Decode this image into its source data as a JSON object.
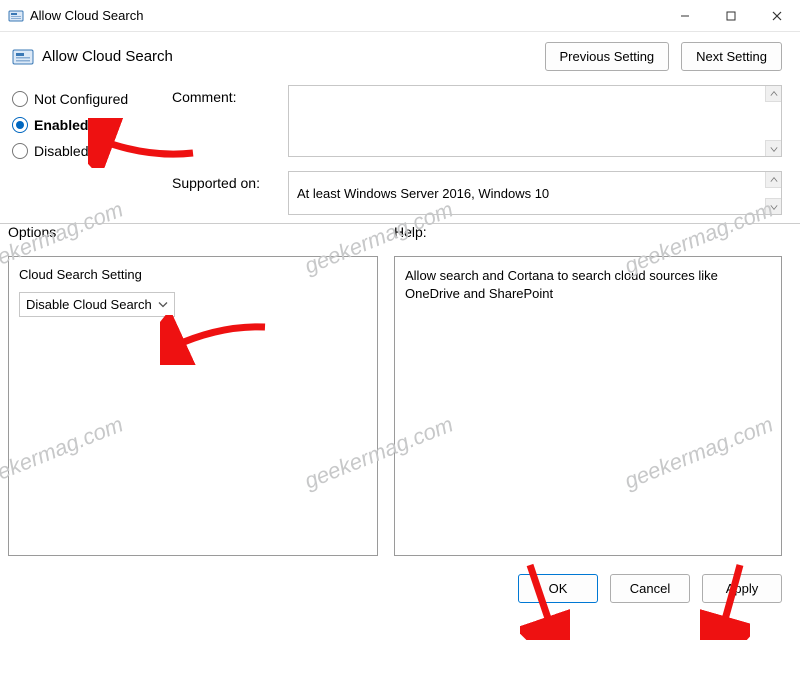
{
  "window": {
    "title": "Allow Cloud Search"
  },
  "header": {
    "policy_name": "Allow Cloud Search",
    "prev_label": "Previous Setting",
    "next_label": "Next Setting"
  },
  "state": {
    "options": [
      "Not Configured",
      "Enabled",
      "Disabled"
    ],
    "selected_index": 1
  },
  "fields": {
    "comment_label": "Comment:",
    "comment_value": "",
    "supported_label": "Supported on:",
    "supported_value": "At least Windows Server 2016, Windows 10"
  },
  "panes": {
    "options_label": "Options:",
    "help_label": "Help:",
    "option_heading": "Cloud Search Setting",
    "selected_option": "Disable Cloud Search",
    "help_text": "Allow search and Cortana to search cloud sources like OneDrive and SharePoint"
  },
  "footer": {
    "ok": "OK",
    "cancel": "Cancel",
    "apply": "Apply"
  },
  "watermark": "geekermag.com"
}
